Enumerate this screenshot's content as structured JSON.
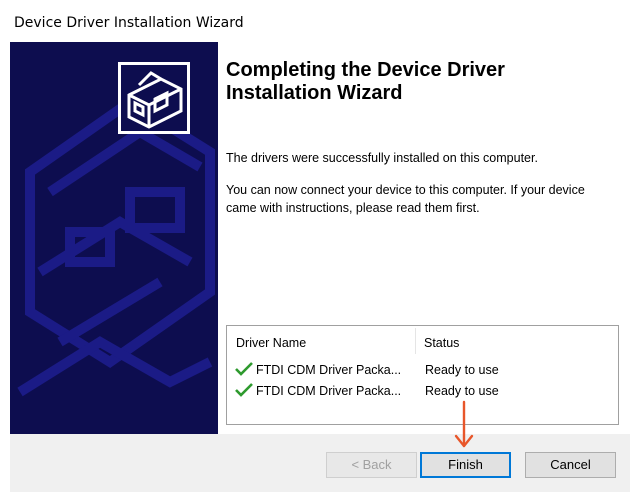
{
  "window": {
    "title": "Device Driver Installation Wizard"
  },
  "colors": {
    "banner": "#0d0d4f",
    "accent": "#0078d7",
    "arrow": "#e8562a",
    "check": "#2e9a2e"
  },
  "main": {
    "heading_line1": "Completing the Device Driver",
    "heading_line2": "Installation Wizard",
    "message1": "The drivers were successfully installed on this computer.",
    "message2_line1": "You can now connect your device to this computer. If your device",
    "message2_line2": "came with instructions, please read them first."
  },
  "drivers": {
    "headers": {
      "name": "Driver Name",
      "status": "Status"
    },
    "rows": [
      {
        "icon": "check-icon",
        "name": "FTDI CDM Driver Packa...",
        "status": "Ready to use"
      },
      {
        "icon": "check-icon",
        "name": "FTDI CDM Driver Packa...",
        "status": "Ready to use"
      }
    ]
  },
  "buttons": {
    "back": "< Back",
    "finish": "Finish",
    "cancel": "Cancel"
  }
}
